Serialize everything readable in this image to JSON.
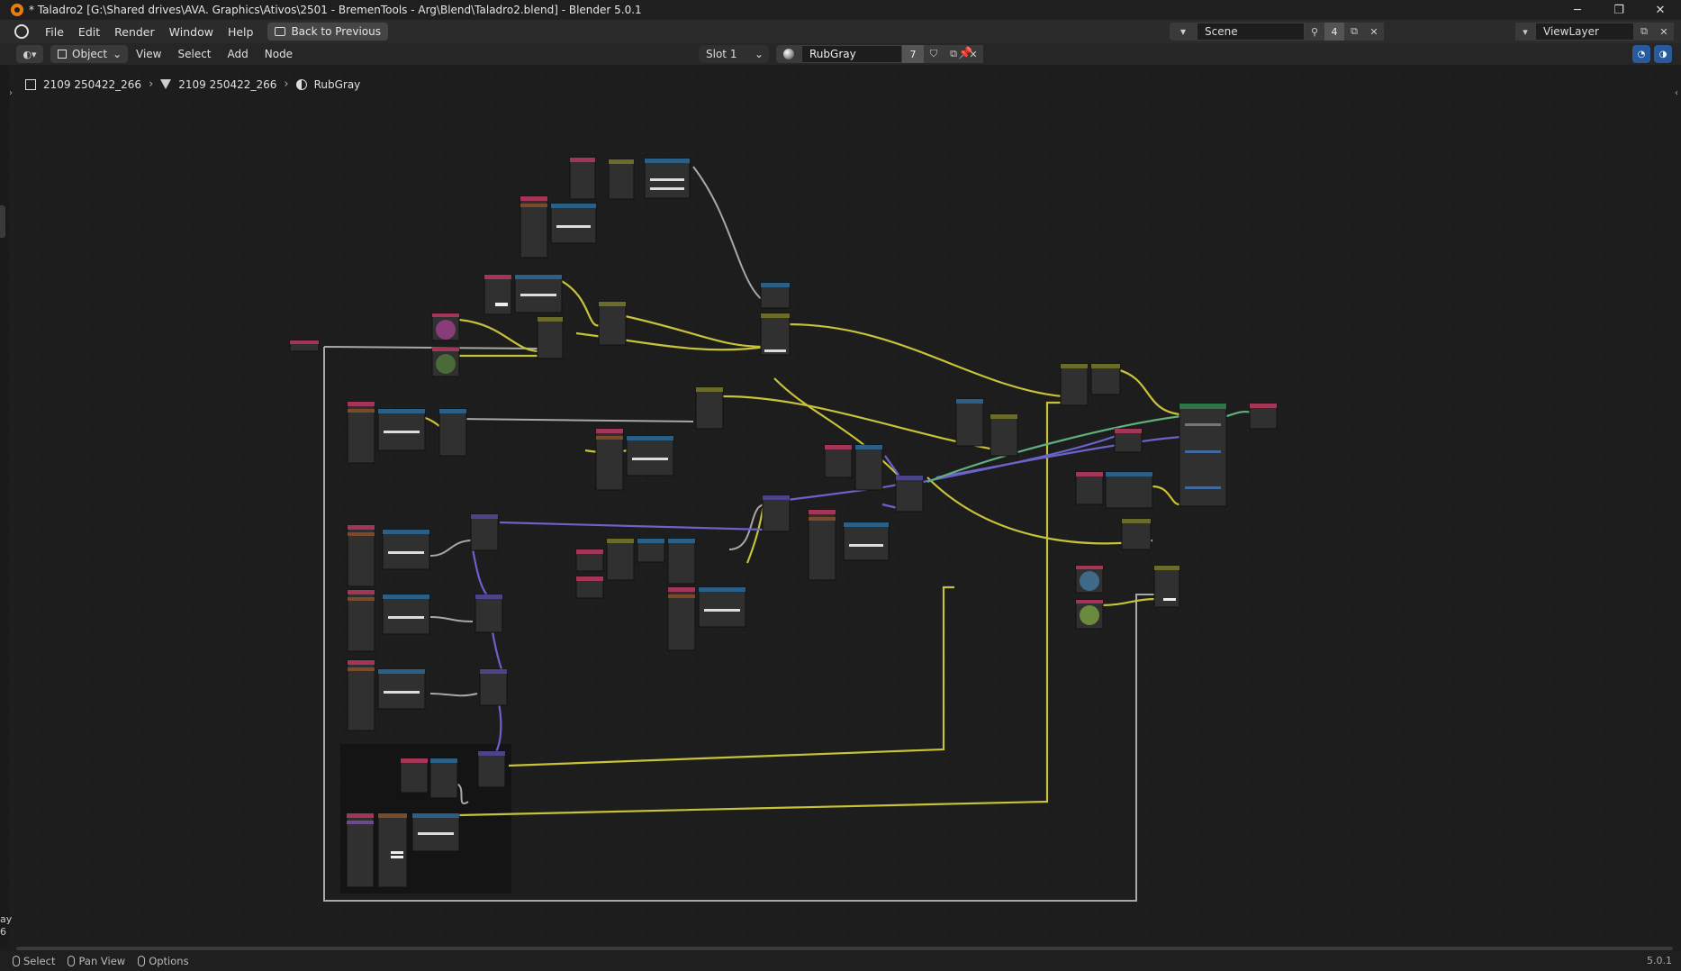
{
  "window": {
    "title": "* Taladro2 [G:\\Shared drives\\AVA. Graphics\\Ativos\\2501 - BremenTools - Arg\\Blend\\Taladro2.blend] - Blender 5.0.1",
    "minimize": "─",
    "maximize": "❐",
    "close": "✕"
  },
  "topbar": {
    "menus": [
      "File",
      "Edit",
      "Render",
      "Window",
      "Help"
    ],
    "back_label": "Back to Previous",
    "scene_name": "Scene",
    "scene_count": "4",
    "view_layer": "ViewLayer"
  },
  "header": {
    "mode": "Object",
    "menus": [
      "View",
      "Select",
      "Add",
      "Node"
    ],
    "slot": "Slot 1",
    "material": "RubGray",
    "material_users": "7"
  },
  "breadcrumb": {
    "object": "2109 250422_266",
    "mesh": "2109 250422_266",
    "material": "RubGray"
  },
  "statusbar": {
    "select": "Select",
    "pan": "Pan View",
    "options": "Options",
    "version": "5.0.1",
    "edge_text_1": "ay",
    "edge_text_2": "6"
  },
  "colors": {
    "link_yellow": "#c8c23a",
    "link_gray": "#a8a8a8",
    "link_purple": "#6b63c9",
    "link_green": "#5fb07a",
    "node_body": "#303030",
    "header_pink": "#a33556",
    "header_blue": "#2a5f88",
    "header_olive": "#6b6b2a",
    "header_purple": "#4c4488",
    "header_green": "#2e7548"
  }
}
